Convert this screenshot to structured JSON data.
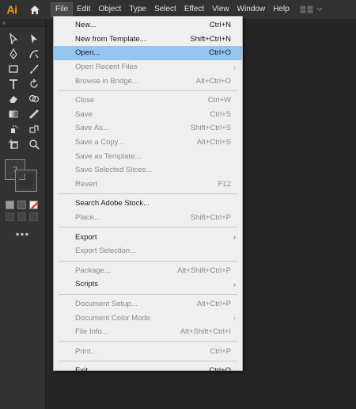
{
  "app": {
    "logo_text": "Ai",
    "brand_color": "#ff9a00"
  },
  "menubar": {
    "items": [
      "File",
      "Edit",
      "Object",
      "Type",
      "Select",
      "Effect",
      "View",
      "Window",
      "Help"
    ],
    "active_index": 0
  },
  "toolbar": {
    "collapse_label": "«",
    "more_label": "•••"
  },
  "file_menu": {
    "items": [
      {
        "label": "New...",
        "shortcut": "Ctrl+N",
        "disabled": false
      },
      {
        "label": "New from Template...",
        "shortcut": "Shift+Ctrl+N",
        "disabled": false
      },
      {
        "label": "Open...",
        "shortcut": "Ctrl+O",
        "disabled": false,
        "highlight": true
      },
      {
        "label": "Open Recent Files",
        "shortcut": "",
        "disabled": true,
        "submenu": true
      },
      {
        "label": "Browse in Bridge...",
        "shortcut": "Alt+Ctrl+O",
        "disabled": true
      },
      {
        "separator": true
      },
      {
        "label": "Close",
        "shortcut": "Ctrl+W",
        "disabled": true
      },
      {
        "label": "Save",
        "shortcut": "Ctrl+S",
        "disabled": true
      },
      {
        "label": "Save As...",
        "shortcut": "Shift+Ctrl+S",
        "disabled": true
      },
      {
        "label": "Save a Copy...",
        "shortcut": "Alt+Ctrl+S",
        "disabled": true
      },
      {
        "label": "Save as Template...",
        "shortcut": "",
        "disabled": true
      },
      {
        "label": "Save Selected Slices...",
        "shortcut": "",
        "disabled": true
      },
      {
        "label": "Revert",
        "shortcut": "F12",
        "disabled": true
      },
      {
        "separator": true
      },
      {
        "label": "Search Adobe Stock...",
        "shortcut": "",
        "disabled": false
      },
      {
        "label": "Place...",
        "shortcut": "Shift+Ctrl+P",
        "disabled": true
      },
      {
        "separator": true
      },
      {
        "label": "Export",
        "shortcut": "",
        "disabled": false,
        "submenu": true
      },
      {
        "label": "Export Selection...",
        "shortcut": "",
        "disabled": true
      },
      {
        "separator": true
      },
      {
        "label": "Package...",
        "shortcut": "Alt+Shift+Ctrl+P",
        "disabled": true
      },
      {
        "label": "Scripts",
        "shortcut": "",
        "disabled": false,
        "submenu": true
      },
      {
        "separator": true
      },
      {
        "label": "Document Setup...",
        "shortcut": "Alt+Ctrl+P",
        "disabled": true
      },
      {
        "label": "Document Color Mode",
        "shortcut": "",
        "disabled": true,
        "submenu": true
      },
      {
        "label": "File Info...",
        "shortcut": "Alt+Shift+Ctrl+I",
        "disabled": true
      },
      {
        "separator": true
      },
      {
        "label": "Print...",
        "shortcut": "Ctrl+P",
        "disabled": true
      },
      {
        "separator": true
      },
      {
        "label": "Exit",
        "shortcut": "Ctrl+Q",
        "disabled": false
      }
    ]
  },
  "icons": [
    "home-icon",
    "workspace-grid-icon",
    "chevron-down-icon",
    "selection-tool-icon",
    "direct-selection-tool-icon",
    "pen-tool-icon",
    "curvature-tool-icon",
    "rectangle-tool-icon",
    "paintbrush-tool-icon",
    "type-tool-icon",
    "rotate-tool-icon",
    "eraser-tool-icon",
    "shape-builder-tool-icon",
    "gradient-tool-icon",
    "eyedropper-tool-icon",
    "symbol-sprayer-tool-icon",
    "live-paint-tool-icon",
    "artboard-tool-icon",
    "zoom-tool-icon",
    "submenu-arrow-icon"
  ]
}
